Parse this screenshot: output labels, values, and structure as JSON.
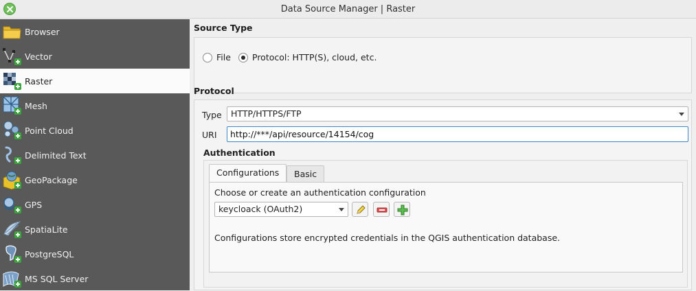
{
  "window": {
    "title": "Data Source Manager | Raster"
  },
  "sidebar": {
    "items": [
      {
        "label": "Browser",
        "icon": "folder-icon",
        "active": false
      },
      {
        "label": "Vector",
        "icon": "vector-icon",
        "active": false
      },
      {
        "label": "Raster",
        "icon": "raster-icon",
        "active": true
      },
      {
        "label": "Mesh",
        "icon": "mesh-icon",
        "active": false
      },
      {
        "label": "Point Cloud",
        "icon": "point-cloud-icon",
        "active": false
      },
      {
        "label": "Delimited Text",
        "icon": "delimited-text-icon",
        "active": false
      },
      {
        "label": "GeoPackage",
        "icon": "geopackage-icon",
        "active": false
      },
      {
        "label": "GPS",
        "icon": "gps-icon",
        "active": false
      },
      {
        "label": "SpatiaLite",
        "icon": "spatialite-icon",
        "active": false
      },
      {
        "label": "PostgreSQL",
        "icon": "postgresql-icon",
        "active": false
      },
      {
        "label": "MS SQL Server",
        "icon": "mssql-icon",
        "active": false
      }
    ]
  },
  "source_type": {
    "title": "Source Type",
    "file_label": "File",
    "protocol_label": "Protocol: HTTP(S), cloud, etc.",
    "selected": "protocol"
  },
  "protocol": {
    "title": "Protocol",
    "type_label": "Type",
    "type_value": "HTTP/HTTPS/FTP",
    "uri_label": "URI",
    "uri_value": "http://***/api/resource/14154/cog"
  },
  "authentication": {
    "title": "Authentication",
    "tabs": [
      {
        "label": "Configurations",
        "active": true
      },
      {
        "label": "Basic",
        "active": false
      }
    ],
    "choose_label": "Choose or create an authentication configuration",
    "config_value": "keycloack (OAuth2)",
    "info_text": "Configurations store encrypted credentials in the QGIS authentication database."
  },
  "colors": {
    "sidebar_bg": "#595959",
    "active_bg": "#fbfbfb",
    "accent_focus": "#3d87c9",
    "plus_green": "#3aa53a"
  }
}
